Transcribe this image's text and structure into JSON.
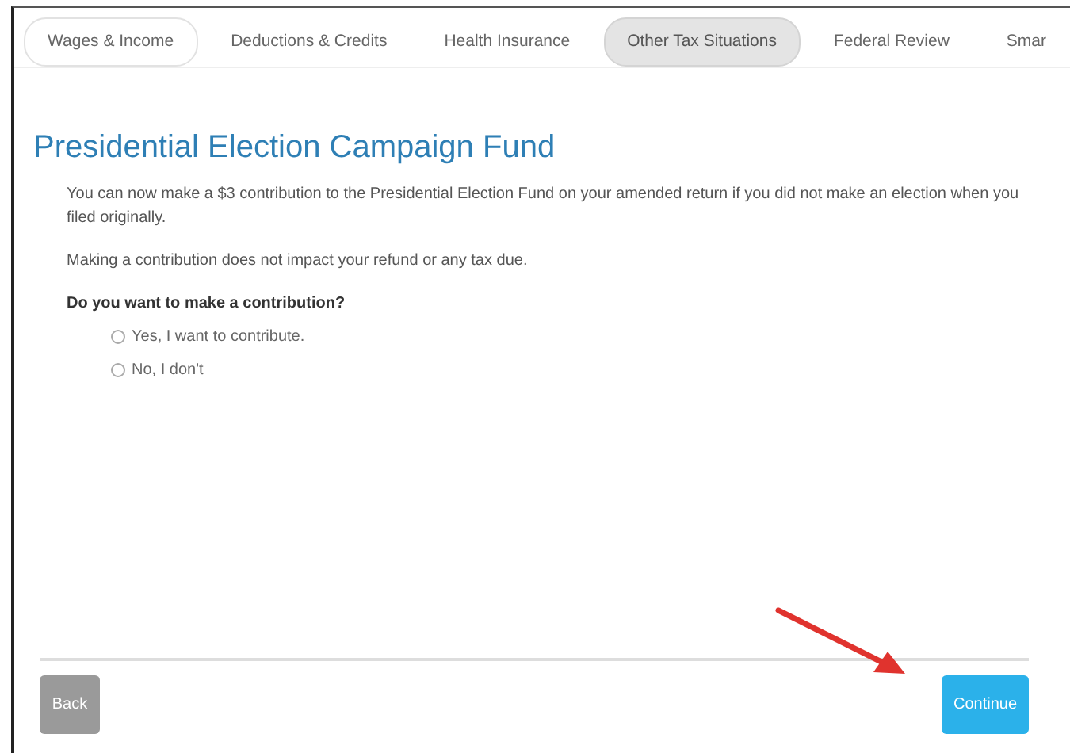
{
  "tabs": [
    {
      "label": "Wages & Income",
      "selected": false,
      "visited": true
    },
    {
      "label": "Deductions & Credits",
      "selected": false,
      "visited": false
    },
    {
      "label": "Health Insurance",
      "selected": false,
      "visited": false
    },
    {
      "label": "Other Tax Situations",
      "selected": true,
      "visited": false
    },
    {
      "label": "Federal Review",
      "selected": false,
      "visited": false
    },
    {
      "label": "Smar",
      "selected": false,
      "visited": false
    }
  ],
  "title": "Presidential Election Campaign Fund",
  "paragraphs": [
    "You can now make a $3 contribution to the Presidential Election Fund on your amended return if you did not make an election when you filed originally.",
    "Making a contribution does not impact your refund or any tax due."
  ],
  "question": "Do you want to make a contribution?",
  "options": [
    {
      "label": "Yes, I want to contribute.",
      "selected": false
    },
    {
      "label": "No, I don't",
      "selected": false
    }
  ],
  "buttons": {
    "back": "Back",
    "continue": "Continue"
  }
}
